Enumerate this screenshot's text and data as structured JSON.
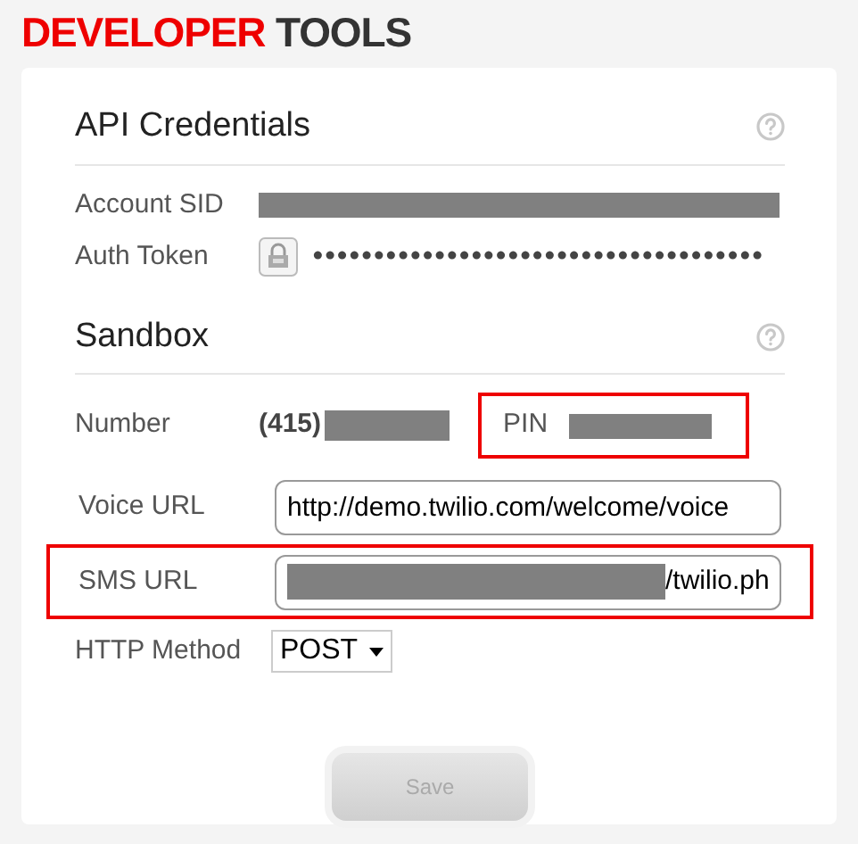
{
  "header": {
    "title_highlight": "DEVELOPER",
    "title_rest": "TOOLS"
  },
  "api_credentials": {
    "heading": "API Credentials",
    "fields": [
      {
        "label": "Account SID",
        "kind": "redacted"
      },
      {
        "label": "Auth Token",
        "kind": "masked",
        "value": "●●●●●●●●●●●●●●●●●●●●●●●●●●●●●●●●●●●●●"
      }
    ]
  },
  "sandbox": {
    "heading": "Sandbox",
    "number": {
      "label": "Number",
      "area_code": "(415)"
    },
    "pin": {
      "label": "PIN",
      "highlighted": true
    },
    "voice_url": {
      "label": "Voice URL",
      "value": "http://demo.twilio.com/welcome/voice"
    },
    "sms_url": {
      "label": "SMS URL",
      "value_tail": "/twilio.ph",
      "highlighted": true
    },
    "http_method": {
      "label": "HTTP Method",
      "value": "POST"
    }
  },
  "save_button": {
    "label": "Save",
    "disabled": true
  }
}
